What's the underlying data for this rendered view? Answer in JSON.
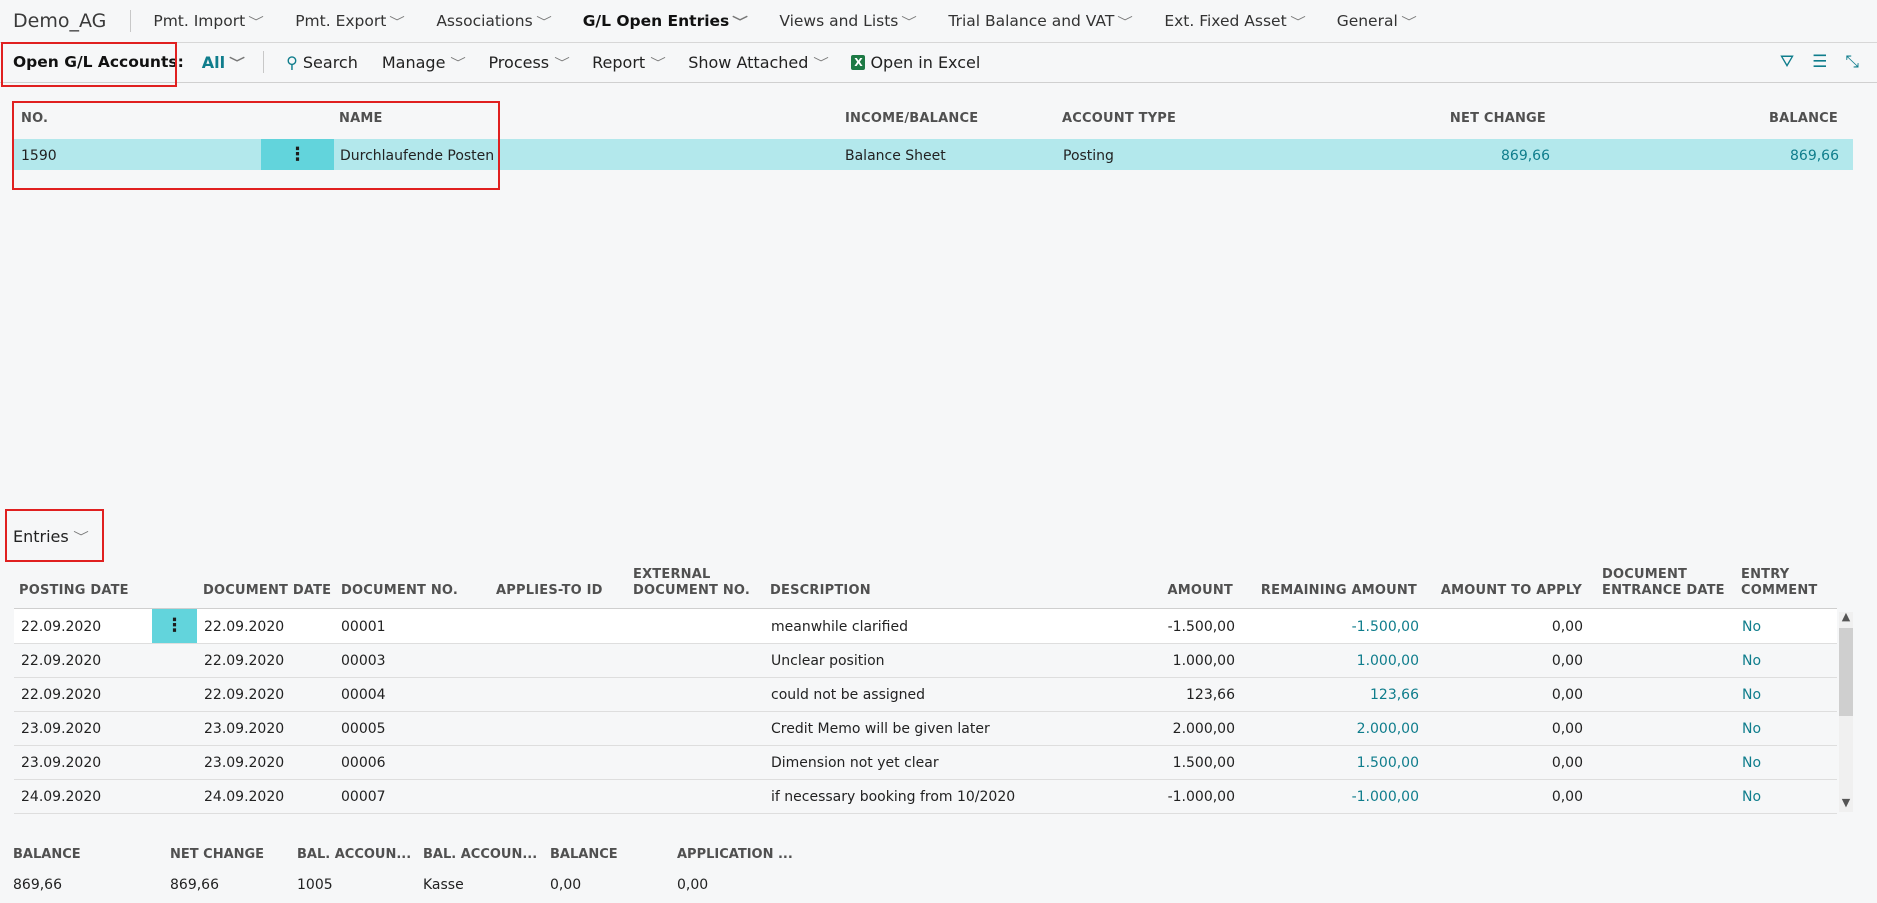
{
  "company": "Demo_AG",
  "nav": [
    "Pmt. Import",
    "Pmt. Export",
    "Associations",
    "G/L Open Entries",
    "Views and Lists",
    "Trial Balance and VAT",
    "Ext. Fixed Asset",
    "General"
  ],
  "actionbar": {
    "title": "Open G/L Accounts:",
    "filter": "All",
    "items": [
      "Search",
      "Manage",
      "Process",
      "Report",
      "Show Attached",
      "Open in Excel"
    ]
  },
  "accounts": {
    "headers": {
      "no": "NO.",
      "name": "NAME",
      "income_balance": "INCOME/BALANCE",
      "account_type": "ACCOUNT TYPE",
      "net_change": "NET CHANGE",
      "balance": "BALANCE"
    },
    "rows": [
      {
        "no": "1590",
        "name": "Durchlaufende Posten",
        "income_balance": "Balance Sheet",
        "account_type": "Posting",
        "net_change": "869,66",
        "balance": "869,66"
      }
    ]
  },
  "entries": {
    "title": "Entries",
    "headers": {
      "posting_date": "POSTING DATE",
      "document_date": "DOCUMENT DATE",
      "document_no": "DOCUMENT NO.",
      "applies_to_id": "APPLIES-TO ID",
      "external_document_no_1": "EXTERNAL",
      "external_document_no_2": "DOCUMENT NO.",
      "description": "DESCRIPTION",
      "amount": "AMOUNT",
      "remaining_amount": "REMAINING AMOUNT",
      "amount_to_apply": "AMOUNT TO APPLY",
      "document_entrance_date_1": "DOCUMENT",
      "document_entrance_date_2": "ENTRANCE DATE",
      "entry_comment_1": "ENTRY",
      "entry_comment_2": "COMMENT"
    },
    "rows": [
      {
        "posting_date": "22.09.2020",
        "document_date": "22.09.2020",
        "document_no": "00001",
        "description": "meanwhile clarified",
        "amount": "-1.500,00",
        "remaining_amount": "-1.500,00",
        "amount_to_apply": "0,00",
        "entry_comment": "No"
      },
      {
        "posting_date": "22.09.2020",
        "document_date": "22.09.2020",
        "document_no": "00003",
        "description": "Unclear position",
        "amount": "1.000,00",
        "remaining_amount": "1.000,00",
        "amount_to_apply": "0,00",
        "entry_comment": "No"
      },
      {
        "posting_date": "22.09.2020",
        "document_date": "22.09.2020",
        "document_no": "00004",
        "description": "could not be assigned",
        "amount": "123,66",
        "remaining_amount": "123,66",
        "amount_to_apply": "0,00",
        "entry_comment": "No"
      },
      {
        "posting_date": "23.09.2020",
        "document_date": "23.09.2020",
        "document_no": "00005",
        "description": "Credit Memo will be given later",
        "amount": "2.000,00",
        "remaining_amount": "2.000,00",
        "amount_to_apply": "0,00",
        "entry_comment": "No"
      },
      {
        "posting_date": "23.09.2020",
        "document_date": "23.09.2020",
        "document_no": "00006",
        "description": "Dimension not yet clear",
        "amount": "1.500,00",
        "remaining_amount": "1.500,00",
        "amount_to_apply": "0,00",
        "entry_comment": "No"
      },
      {
        "posting_date": "24.09.2020",
        "document_date": "24.09.2020",
        "document_no": "00007",
        "description": "if necessary booking from 10/2020",
        "amount": "-1.000,00",
        "remaining_amount": "-1.000,00",
        "amount_to_apply": "0,00",
        "entry_comment": "No"
      }
    ]
  },
  "footer": {
    "headers": [
      "BALANCE",
      "NET CHANGE",
      "BAL. ACCOUN...",
      "BAL. ACCOUN...",
      "BALANCE",
      "APPLICATION ..."
    ],
    "values": [
      "869,66",
      "869,66",
      "1005",
      "Kasse",
      "0,00",
      "0,00"
    ]
  },
  "colors": {
    "accent": "#0f7d8c",
    "selected_row": "#b3e8ec",
    "highlight_box": "#e02020"
  }
}
